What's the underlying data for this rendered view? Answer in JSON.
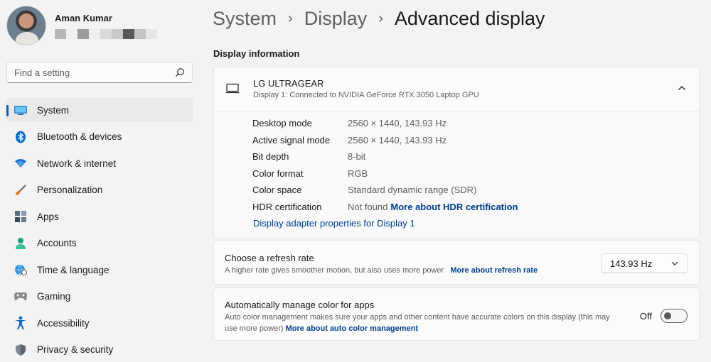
{
  "profile": {
    "name": "Aman Kumar",
    "email_blocks": [
      "#b7b7b7",
      "#f1f1f1",
      "#9a9a9a",
      "#efefef",
      "#d9d9d9",
      "#c9c9c9",
      "#585858",
      "#c4c4c4",
      "#e6e6e6"
    ]
  },
  "search": {
    "placeholder": "Find a setting",
    "icon": "search-icon"
  },
  "sidebar": {
    "items": [
      {
        "label": "System",
        "icon": "system-icon",
        "active": true
      },
      {
        "label": "Bluetooth & devices",
        "icon": "bluetooth-icon"
      },
      {
        "label": "Network & internet",
        "icon": "wifi-icon"
      },
      {
        "label": "Personalization",
        "icon": "brush-icon"
      },
      {
        "label": "Apps",
        "icon": "apps-icon"
      },
      {
        "label": "Accounts",
        "icon": "person-icon"
      },
      {
        "label": "Time & language",
        "icon": "globe-clock-icon"
      },
      {
        "label": "Gaming",
        "icon": "gamepad-icon"
      },
      {
        "label": "Accessibility",
        "icon": "accessibility-icon"
      },
      {
        "label": "Privacy & security",
        "icon": "shield-icon"
      }
    ]
  },
  "breadcrumb": {
    "part1": "System",
    "part2": "Display",
    "current": "Advanced display"
  },
  "display_info": {
    "section_title": "Display information",
    "monitor_name": "LG ULTRAGEAR",
    "monitor_sub": "Display 1: Connected to NVIDIA GeForce RTX 3050 Laptop GPU",
    "rows": [
      {
        "label": "Desktop mode",
        "value": "2560 × 1440, 143.93 Hz"
      },
      {
        "label": "Active signal mode",
        "value": "2560 × 1440, 143.93 Hz"
      },
      {
        "label": "Bit depth",
        "value": "8-bit"
      },
      {
        "label": "Color format",
        "value": "RGB"
      },
      {
        "label": "Color space",
        "value": "Standard dynamic range (SDR)"
      },
      {
        "label": "HDR certification",
        "value": "Not found",
        "link": "More about HDR certification"
      }
    ],
    "adapter_link": "Display adapter properties for Display 1"
  },
  "refresh": {
    "title": "Choose a refresh rate",
    "desc": "A higher rate gives smoother motion, but also uses more power",
    "link": "More about refresh rate",
    "selected": "143.93 Hz"
  },
  "color_mgmt": {
    "title": "Automatically manage color for apps",
    "desc_line1": "Auto color management makes sure your apps and other content have accurate colors on this display (this may",
    "desc_line2": "use more power)",
    "link": "More about auto color management",
    "toggle_label": "Off",
    "toggle_on": false
  },
  "colors": {
    "accent": "#005fb8",
    "link": "#003e92"
  }
}
